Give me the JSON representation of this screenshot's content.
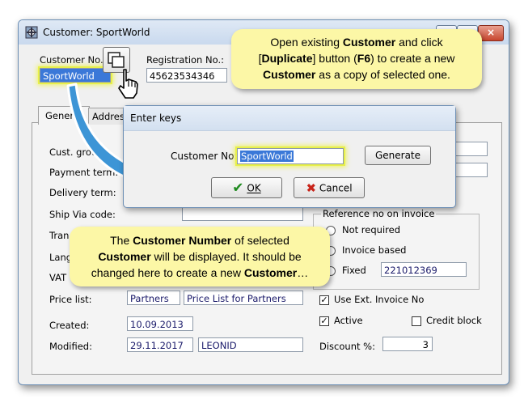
{
  "window": {
    "title": "Customer: SportWorld",
    "customer_no_label": "Customer No.:",
    "customer_no_value": "SportWorld",
    "registration_no_label": "Registration No.:",
    "registration_no_value": "45623534346",
    "tabs": [
      "General",
      "Address"
    ],
    "labels": {
      "cust_group": "Cust. grou",
      "payment_term": "Payment term:",
      "delivery_term": "Delivery term:",
      "ship_via": "Ship Via code:",
      "tran": "Tran",
      "lang": "Lang",
      "vat": "VAT",
      "price_list": "Price list:",
      "created": "Created:",
      "modified": "Modified:"
    },
    "price_list_code": "Partners",
    "price_list_name": "Price List for Partners",
    "created_value": "10.09.2013",
    "modified_date": "29.11.2017",
    "modified_user": "LEONID",
    "ship_via_partial": "",
    "reference_group_label": "Reference no on invoice",
    "options": {
      "not_required": "Not required",
      "invoice_based": "Invoice based",
      "fixed": "Fixed",
      "fixed_value": "221012369"
    },
    "use_ext_invoice": "Use Ext. Invoice No",
    "active": "Active",
    "credit_block": "Credit block",
    "discount_label": "Discount %:",
    "discount_value": "3"
  },
  "dialog": {
    "title": "Enter keys",
    "customer_no_label": "Customer No:",
    "customer_no_value": "SportWorld",
    "generate_button": "Generate",
    "ok_button": "OK",
    "cancel_button": "Cancel"
  },
  "callouts": {
    "top": {
      "t1": "Open existing ",
      "b1": "Customer",
      "t2": " and click",
      "t3": "[",
      "b2": "Duplicate",
      "t4": "] button (",
      "b3": "F6",
      "t5": ") to create a new",
      "b4": "Customer",
      "t6": " as a copy of selected one."
    },
    "bottom": {
      "t1": "The ",
      "b1": "Customer Number",
      "t2": " of selected",
      "b2": "Customer",
      "t3": " will be displayed.  It should be",
      "t4": "changed here to create a new ",
      "b3": "Customer",
      "t5": "…"
    }
  },
  "colors": {
    "callout_bg": "#fcf7a6",
    "highlight": "#e8f04a",
    "arrow": "#3d95d6",
    "field_text": "#1a1a6a"
  }
}
